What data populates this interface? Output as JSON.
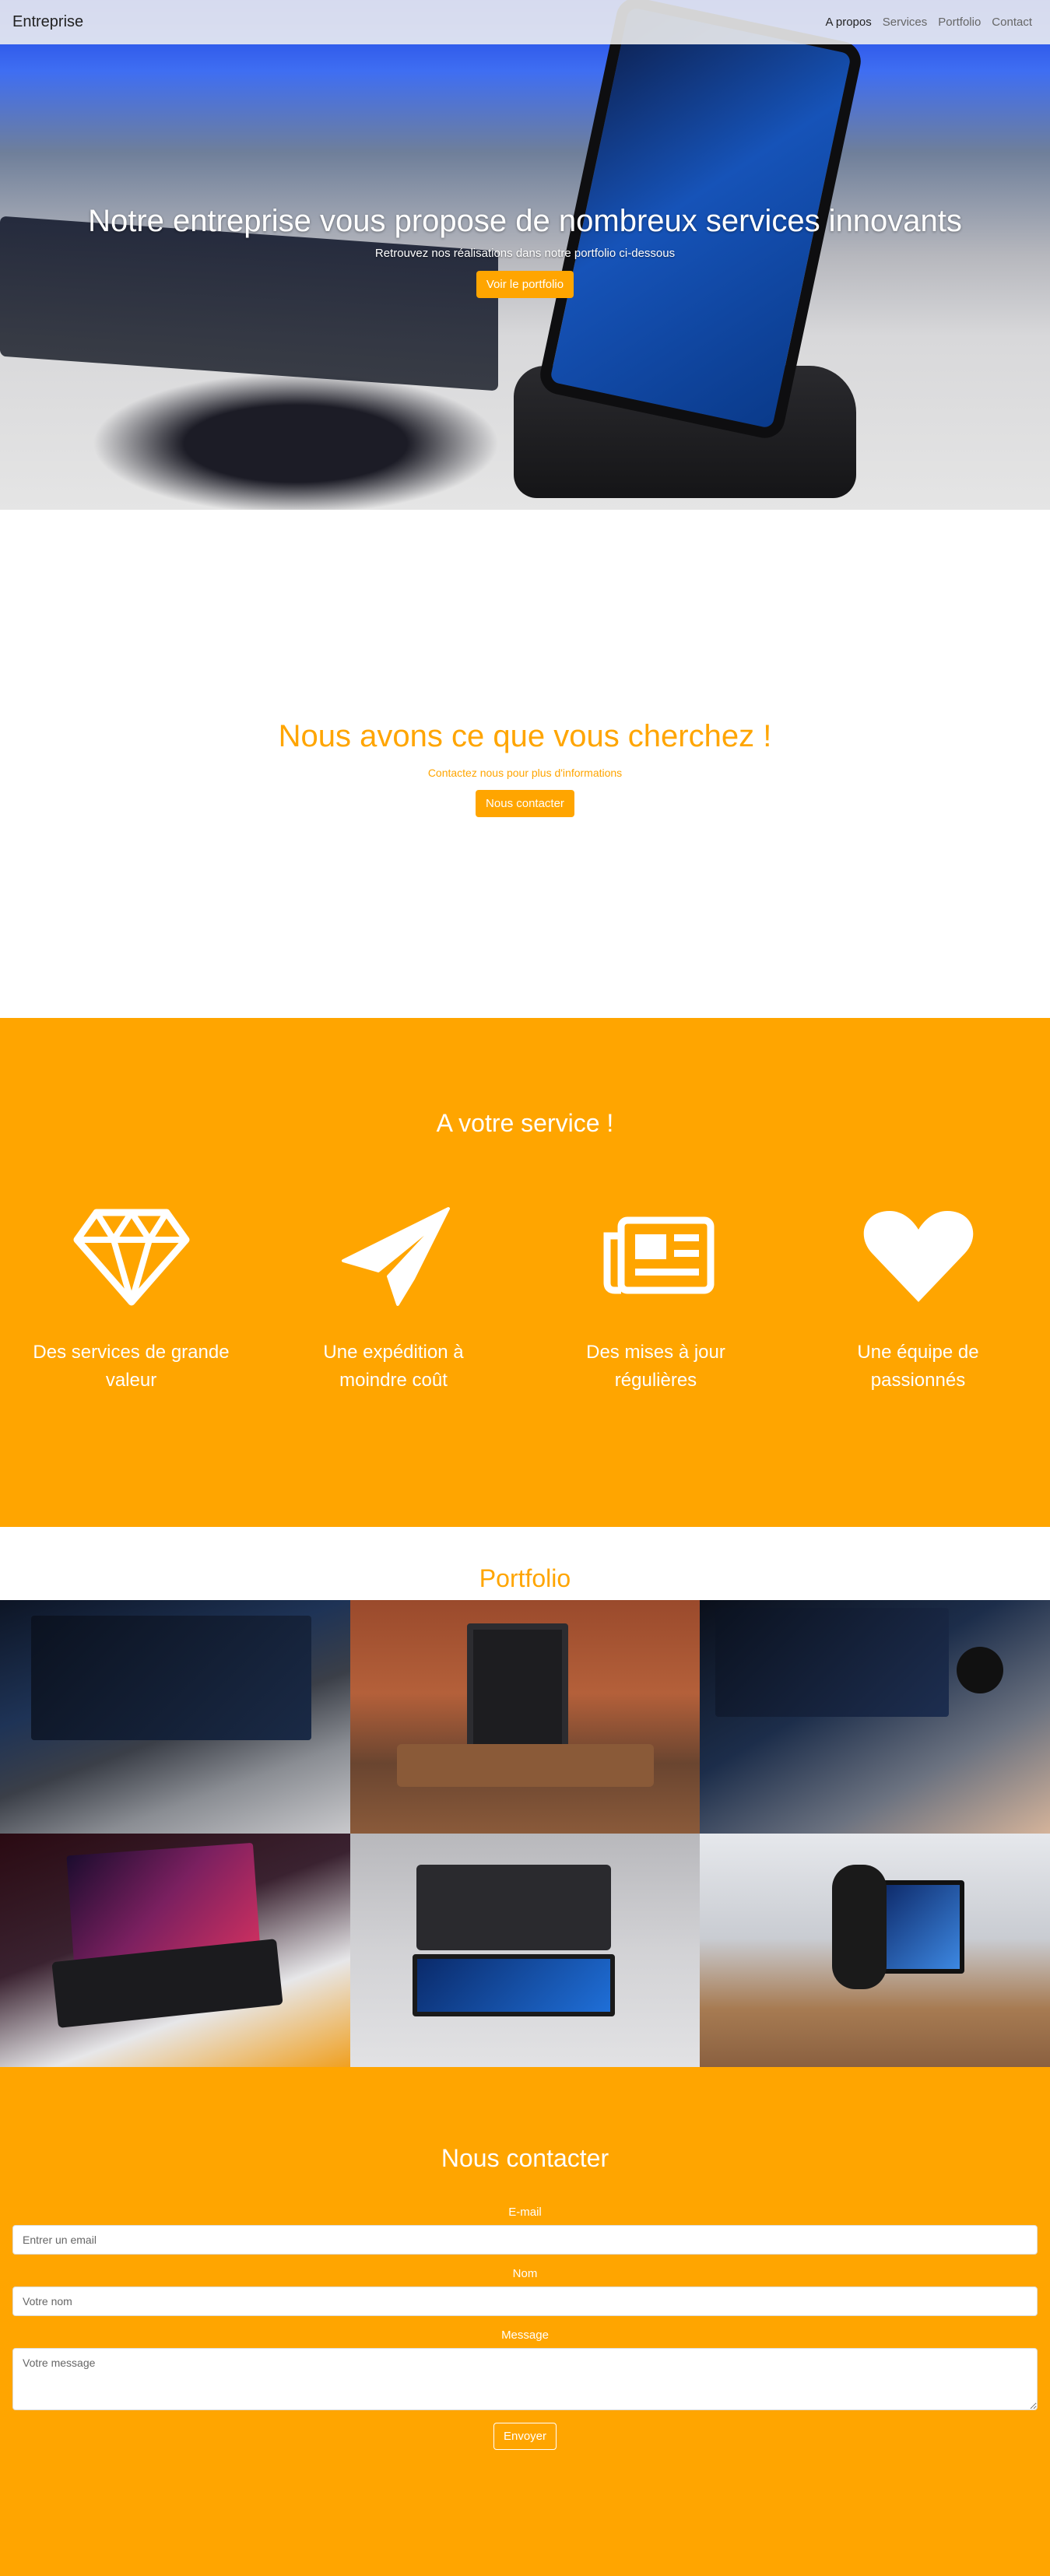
{
  "navbar": {
    "brand": "Entreprise",
    "links": [
      {
        "label": "A propos",
        "active": true
      },
      {
        "label": "Services",
        "active": false
      },
      {
        "label": "Portfolio",
        "active": false
      },
      {
        "label": "Contact",
        "active": false
      }
    ]
  },
  "hero": {
    "title": "Notre entreprise vous propose de nombreux services innovants",
    "subtitle": "Retrouvez nos réalisations dans notre portfolio ci-dessous",
    "button": "Voir le portfolio"
  },
  "about": {
    "title": "Nous avons ce que vous cherchez !",
    "subtitle": "Contactez nous pour plus d'informations",
    "button": "Nous contacter"
  },
  "services": {
    "title": "A votre service !",
    "items": [
      {
        "label": "Des services de grande valeur",
        "icon": "diamond-icon"
      },
      {
        "label": "Une expédition à moindre coût",
        "icon": "paper-plane-icon"
      },
      {
        "label": "Des mises à jour régulières",
        "icon": "newspaper-icon"
      },
      {
        "label": "Une équipe de passionnés",
        "icon": "heart-icon"
      }
    ]
  },
  "portfolio": {
    "title": "Portfolio"
  },
  "contact": {
    "title": "Nous contacter",
    "email_label": "E-mail",
    "email_placeholder": "Entrer un email",
    "name_label": "Nom",
    "name_placeholder": "Votre nom",
    "message_label": "Message",
    "message_placeholder": "Votre message",
    "submit": "Envoyer"
  },
  "colors": {
    "accent": "#ffa500",
    "white": "#ffffff"
  }
}
